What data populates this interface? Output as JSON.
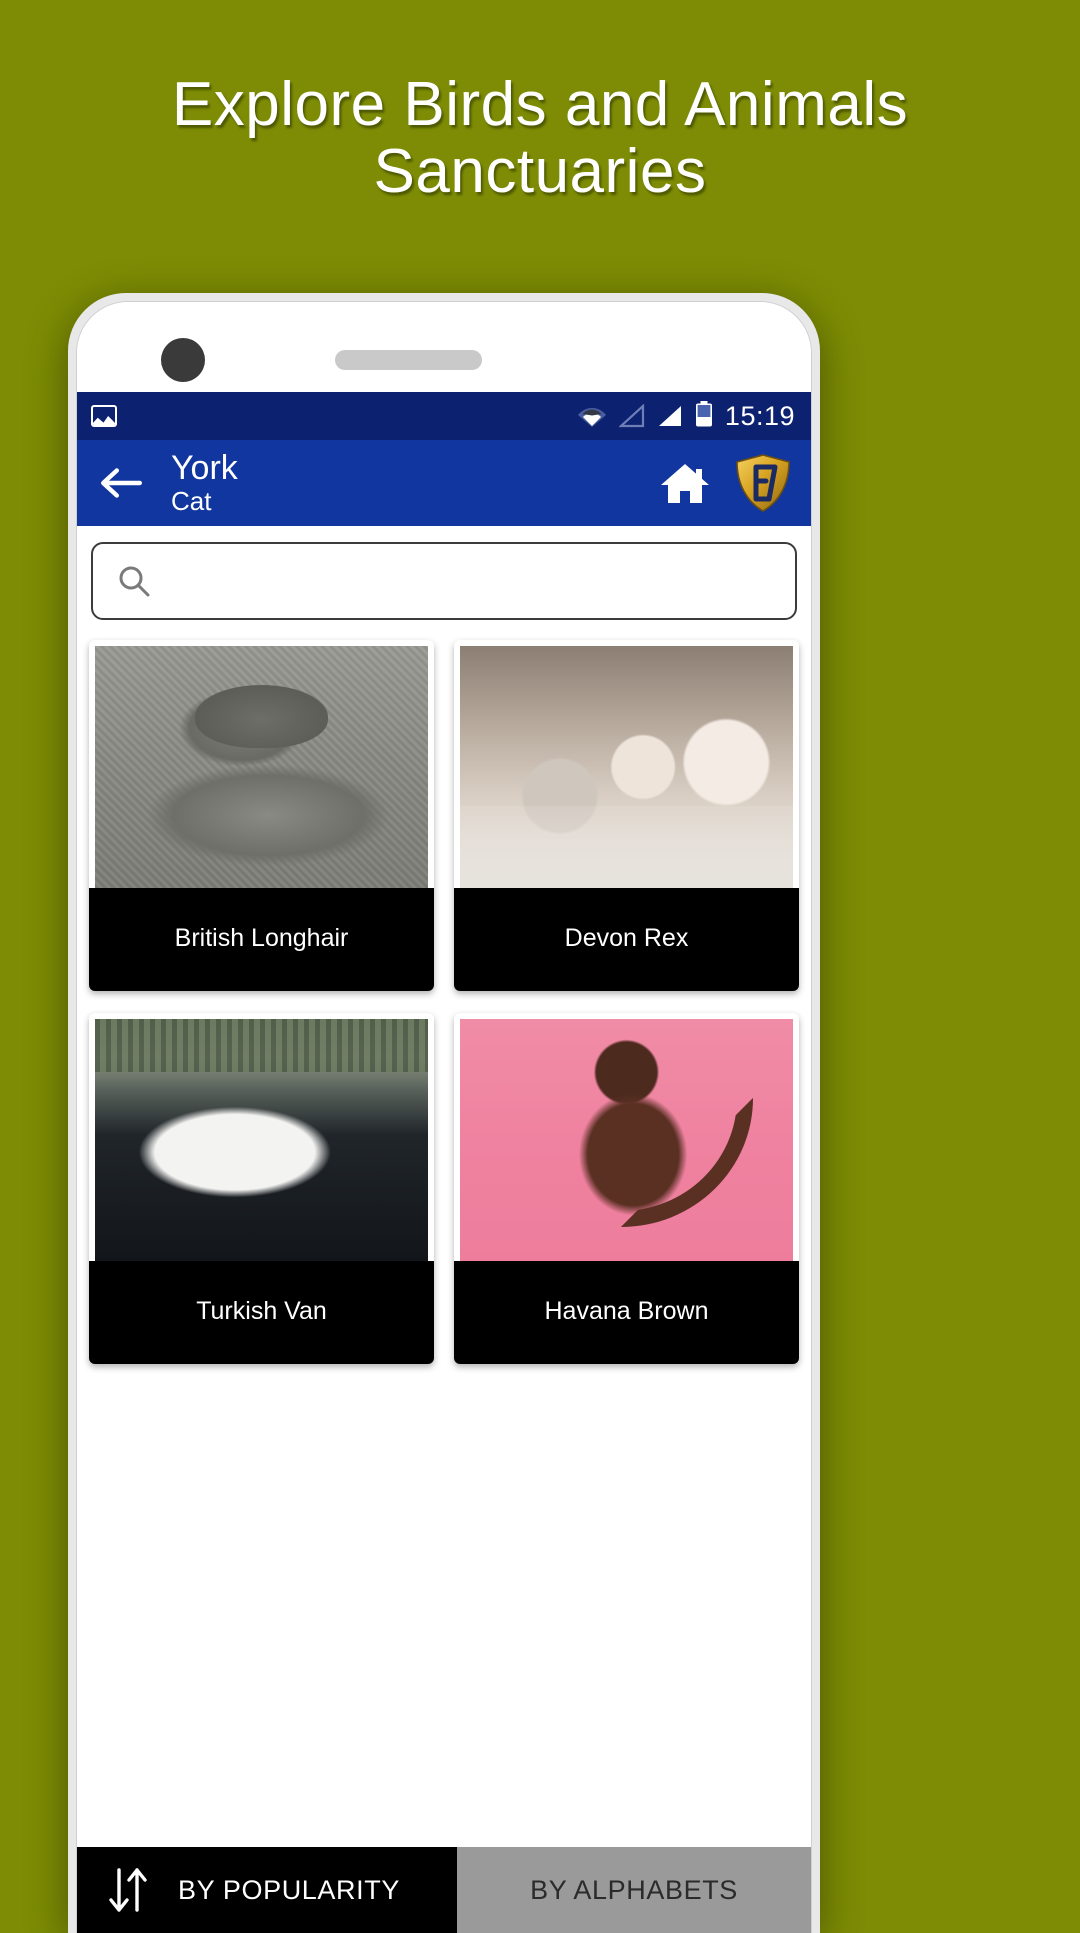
{
  "promo": {
    "headline": "Explore Birds and Animals Sanctuaries",
    "background_color": "#7d8c04"
  },
  "statusbar": {
    "background_color": "#0d2171",
    "clock": "15:19",
    "icons": [
      "photo-icon",
      "wifi-icon",
      "signal-empty-icon",
      "signal-full-icon",
      "battery-icon"
    ]
  },
  "appbar": {
    "background_color": "#11369f",
    "back_icon": "back-arrow-icon",
    "title": "York",
    "subtitle": "Cat",
    "home_icon": "home-icon",
    "logo_text": "EV",
    "logo_colors": {
      "gold": "#e8b830",
      "dark_gold": "#8a6413"
    }
  },
  "search": {
    "value": "",
    "placeholder": "",
    "icon": "search-icon"
  },
  "grid": {
    "cards": [
      {
        "label": "British Longhair",
        "photo": "grey-cat-on-fabric"
      },
      {
        "label": "Devon Rex",
        "photo": "three-pale-kittens"
      },
      {
        "label": "Turkish Van",
        "photo": "white-cat-on-dashboard"
      },
      {
        "label": "Havana Brown",
        "photo": "brown-cat-on-pink"
      }
    ]
  },
  "sortbar": {
    "icon": "sort-arrows-icon",
    "active_label": "BY POPULARITY",
    "inactive_label": "BY ALPHABETS",
    "active_background": "#000000",
    "inactive_background": "#9a9a9a"
  }
}
